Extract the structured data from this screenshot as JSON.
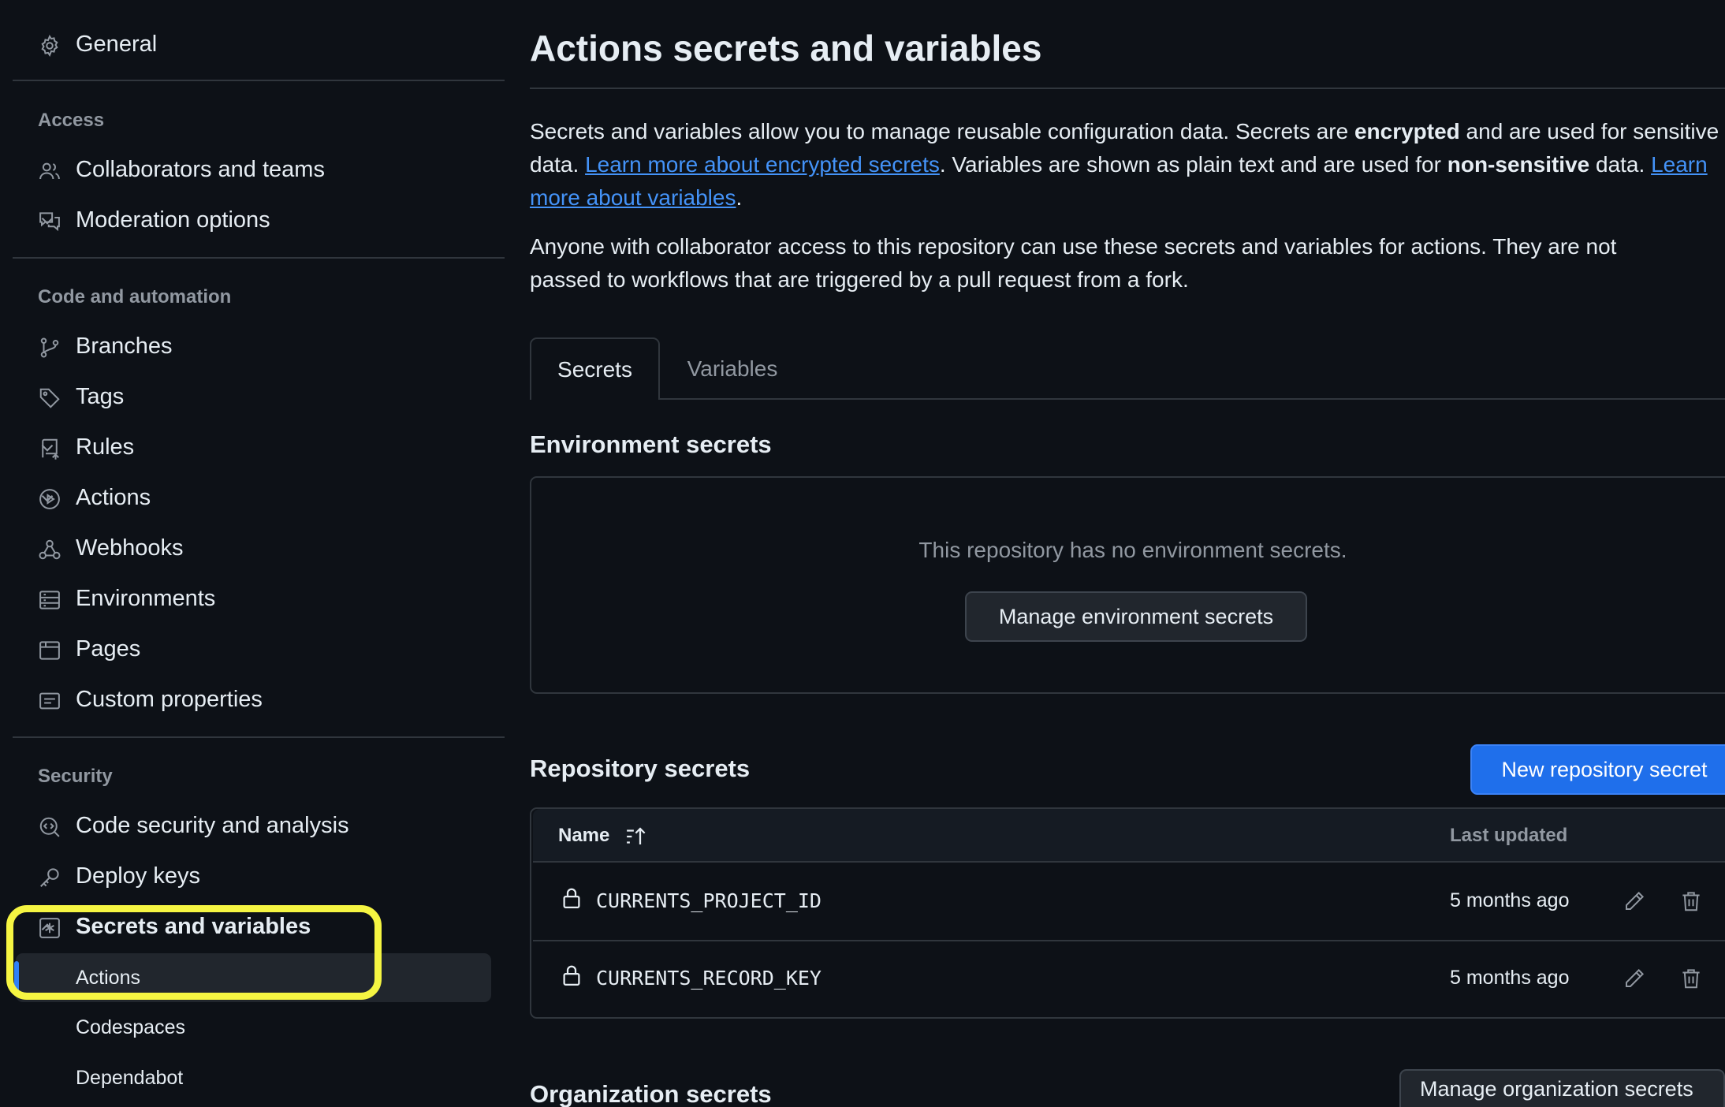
{
  "sidebar": {
    "general": "General",
    "access_title": "Access",
    "collaborators": "Collaborators and teams",
    "moderation": "Moderation options",
    "code_title": "Code and automation",
    "branches": "Branches",
    "tags": "Tags",
    "rules": "Rules",
    "actions": "Actions",
    "webhooks": "Webhooks",
    "environments": "Environments",
    "pages": "Pages",
    "custom_properties": "Custom properties",
    "security_title": "Security",
    "code_security": "Code security and analysis",
    "deploy_keys": "Deploy keys",
    "secrets_variables": "Secrets and variables",
    "sub_actions": "Actions",
    "sub_codespaces": "Codespaces",
    "sub_dependabot": "Dependabot"
  },
  "main": {
    "title": "Actions secrets and variables",
    "intro": {
      "p1_a": "Secrets and variables allow you to manage reusable configuration data. Secrets are ",
      "p1_b": "encrypted",
      "p1_c": " and are used for sensitive data. ",
      "p1_link1": "Learn more about encrypted secrets",
      "p1_d": ". Variables are shown as plain text and are used for ",
      "p1_e": "non-sensitive",
      "p1_f": " data. ",
      "p1_link2": "Learn more about variables",
      "p1_g": ".",
      "p2": "Anyone with collaborator access to this repository can use these secrets and variables for actions. They are not passed to workflows that are triggered by a pull request from a fork."
    },
    "tabs": {
      "secrets": "Secrets",
      "variables": "Variables"
    },
    "env_secrets": {
      "title": "Environment secrets",
      "empty": "This repository has no environment secrets.",
      "button": "Manage environment secrets"
    },
    "repo_secrets": {
      "title": "Repository secrets",
      "new_button": "New repository secret",
      "col_name": "Name",
      "col_updated": "Last updated",
      "rows": [
        {
          "name": "CURRENTS_PROJECT_ID",
          "updated": "5 months ago"
        },
        {
          "name": "CURRENTS_RECORD_KEY",
          "updated": "5 months ago"
        }
      ]
    },
    "org_secrets": {
      "title": "Organization secrets",
      "button": "Manage organization secrets"
    }
  },
  "colors": {
    "background": "#0d1117",
    "accent": "#1f6feb",
    "link": "#4493f8",
    "highlight": "#f5f542"
  }
}
